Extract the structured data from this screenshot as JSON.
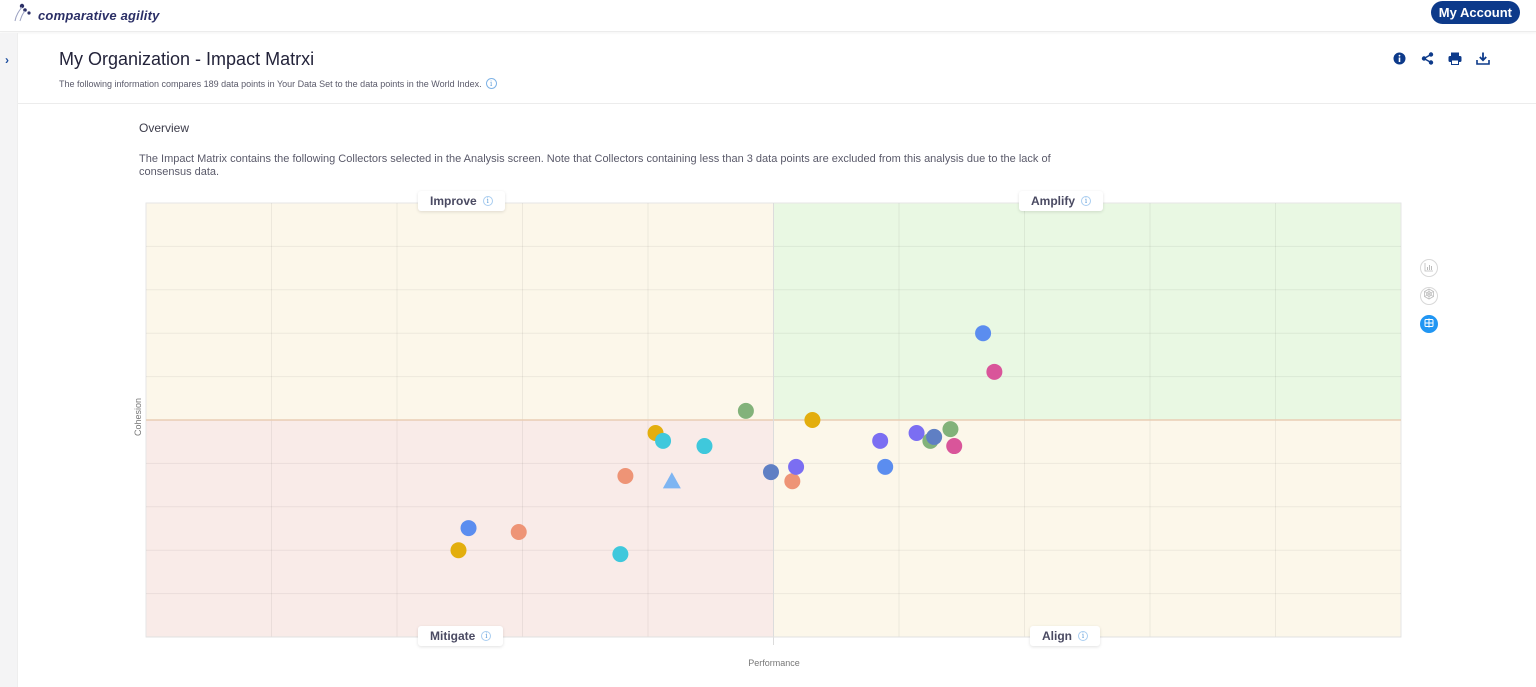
{
  "app": {
    "brand": "comparative agility",
    "account_button": "My Account"
  },
  "header": {
    "title": "My Organization - Impact Matrxi",
    "subtitle": "The following information compares 189 data points in Your Data Set to the data points in the World Index.",
    "actions": [
      "info-icon",
      "share-icon",
      "print-icon",
      "download-icon"
    ]
  },
  "overview": {
    "label": "Overview",
    "description": "The Impact Matrix contains the following Collectors selected in the Analysis screen. Note that Collectors containing less than 3 data points are excluded from this analysis due to the lack of consensus data."
  },
  "view_switcher": {
    "options": [
      "bar-chart-icon",
      "radar-chart-icon",
      "matrix-icon"
    ],
    "active": "matrix-icon"
  },
  "colors": {
    "accent": "#0d3a8a",
    "improve_bg": "#fcf7ea",
    "amplify_bg": "#e9f8e3",
    "mitigate_bg": "#f9ebe8",
    "align_bg": "#fcf7ea",
    "active_view": "#2196f3"
  },
  "chart_data": {
    "type": "scatter",
    "title": "",
    "xlabel": "Performance",
    "ylabel": "Cohesion",
    "xlim": [
      0,
      100
    ],
    "ylim": [
      0,
      100
    ],
    "x_midpoint": 50,
    "y_midpoint": 50,
    "grid": true,
    "grid_divisions_x": 10,
    "grid_divisions_y": 10,
    "tick_labels_shown": false,
    "quadrants": [
      {
        "name": "Improve",
        "position": "top-left"
      },
      {
        "name": "Amplify",
        "position": "top-right"
      },
      {
        "name": "Mitigate",
        "position": "bottom-left"
      },
      {
        "name": "Align",
        "position": "bottom-right"
      }
    ],
    "points": [
      {
        "x": 66.7,
        "y": 70.0,
        "color": "#5b8def",
        "shape": "circle"
      },
      {
        "x": 67.6,
        "y": 61.1,
        "color": "#d9559a",
        "shape": "circle"
      },
      {
        "x": 47.8,
        "y": 52.1,
        "color": "#82b27a",
        "shape": "circle"
      },
      {
        "x": 53.1,
        "y": 50.0,
        "color": "#e3ae0d",
        "shape": "circle"
      },
      {
        "x": 40.6,
        "y": 47.0,
        "color": "#e3ae0d",
        "shape": "circle"
      },
      {
        "x": 41.2,
        "y": 45.2,
        "color": "#3fc8dc",
        "shape": "circle"
      },
      {
        "x": 44.5,
        "y": 44.0,
        "color": "#3fc8dc",
        "shape": "circle"
      },
      {
        "x": 58.5,
        "y": 45.2,
        "color": "#7b6ef2",
        "shape": "circle"
      },
      {
        "x": 61.4,
        "y": 47.0,
        "color": "#7b6ef2",
        "shape": "circle"
      },
      {
        "x": 62.5,
        "y": 45.2,
        "color": "#82b27a",
        "shape": "circle"
      },
      {
        "x": 64.1,
        "y": 47.9,
        "color": "#82b27a",
        "shape": "circle"
      },
      {
        "x": 62.8,
        "y": 46.1,
        "color": "#5f7fc4",
        "shape": "circle"
      },
      {
        "x": 64.4,
        "y": 44.0,
        "color": "#d9559a",
        "shape": "circle"
      },
      {
        "x": 58.9,
        "y": 39.2,
        "color": "#5b8def",
        "shape": "circle"
      },
      {
        "x": 49.8,
        "y": 38.0,
        "color": "#5f7fc4",
        "shape": "circle"
      },
      {
        "x": 51.5,
        "y": 35.9,
        "color": "#ee9476",
        "shape": "circle"
      },
      {
        "x": 51.8,
        "y": 39.2,
        "color": "#7b6ef2",
        "shape": "circle"
      },
      {
        "x": 38.2,
        "y": 37.1,
        "color": "#ee9476",
        "shape": "circle"
      },
      {
        "x": 41.9,
        "y": 35.9,
        "color": "#7eb5f2",
        "shape": "triangle"
      },
      {
        "x": 25.7,
        "y": 25.1,
        "color": "#5b8def",
        "shape": "circle"
      },
      {
        "x": 29.7,
        "y": 24.2,
        "color": "#ee9476",
        "shape": "circle"
      },
      {
        "x": 24.9,
        "y": 20.0,
        "color": "#e3ae0d",
        "shape": "circle"
      },
      {
        "x": 37.8,
        "y": 19.1,
        "color": "#3fc8dc",
        "shape": "circle"
      }
    ]
  }
}
